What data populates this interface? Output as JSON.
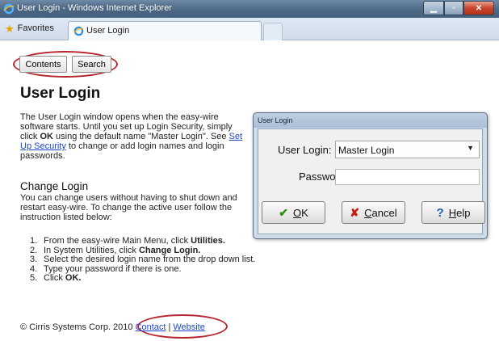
{
  "window": {
    "title": "User Login - Windows Internet Explorer",
    "favorites_label": "Favorites",
    "tab_label": "User Login",
    "colors": {
      "titlebar": "#4f6a87",
      "close_button": "#c7432b"
    }
  },
  "nav": {
    "contents_label": "Contents",
    "search_label": "Search"
  },
  "page": {
    "title": "User Login",
    "intro": {
      "part1": "The User Login window opens when the easy-wire software starts. Until you set up Login Security, simply click ",
      "bold": "OK",
      "part2": " using the default name \"Master Login\". See ",
      "link": "Set Up Security",
      "part3": " to change or add login names and login passwords."
    },
    "change_heading": "Change Login",
    "change_text": "You can change users without having to shut down and restart easy-wire. To change the active user follow the instruction listed below:",
    "steps": [
      {
        "num": "1.",
        "text": "From the easy-wire Main Menu, click ",
        "bold": "Utilities."
      },
      {
        "num": "2.",
        "text": "In System Utilities, click ",
        "bold": "Change Login."
      },
      {
        "num": "3.",
        "text": "Select the desired login name from the drop down list.",
        "bold": ""
      },
      {
        "num": "4.",
        "text": "Type your password if there is one.",
        "bold": ""
      },
      {
        "num": "5.",
        "text": "Click ",
        "bold": "OK."
      }
    ],
    "footer": {
      "copyright": "© Cirris Systems Corp. 2010",
      "contact": "Contact",
      "separator": "|",
      "website": "Website"
    },
    "highlight_color": "#b5262d",
    "link_color": "#1d47c8"
  },
  "dialog": {
    "title": "User Login",
    "user_login_label": "User Login:",
    "user_login_value": "Master Login",
    "password_label": "Password:",
    "password_value": "",
    "ok": {
      "icon": "check-icon",
      "accel": "O",
      "rest": "K"
    },
    "cancel": {
      "icon": "x-icon",
      "accel": "C",
      "rest": "ancel"
    },
    "help": {
      "icon": "question-icon",
      "accel": "H",
      "rest": "elp"
    }
  }
}
